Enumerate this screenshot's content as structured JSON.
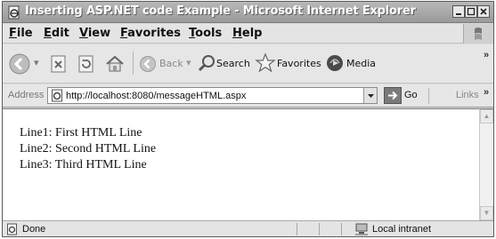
{
  "window": {
    "title": "Inserting ASP.NET code Example - Microsoft Internet Explorer",
    "icon": "ie-page-icon"
  },
  "menu": {
    "items": [
      "File",
      "Edit",
      "View",
      "Favorites",
      "Tools",
      "Help"
    ]
  },
  "toolbar": {
    "back_label": "Back",
    "search_label": "Search",
    "favorites_label": "Favorites",
    "media_label": "Media",
    "overflow": "»"
  },
  "address": {
    "label": "Address",
    "url": "http://localhost:8080/messageHTML.aspx",
    "go_label": "Go",
    "links_label": "Links",
    "overflow": "»"
  },
  "content": {
    "lines": [
      "Line1: First HTML Line",
      "Line2: Second HTML Line",
      "Line3: Third HTML Line"
    ]
  },
  "status": {
    "text": "Done",
    "zone": "Local intranet"
  }
}
